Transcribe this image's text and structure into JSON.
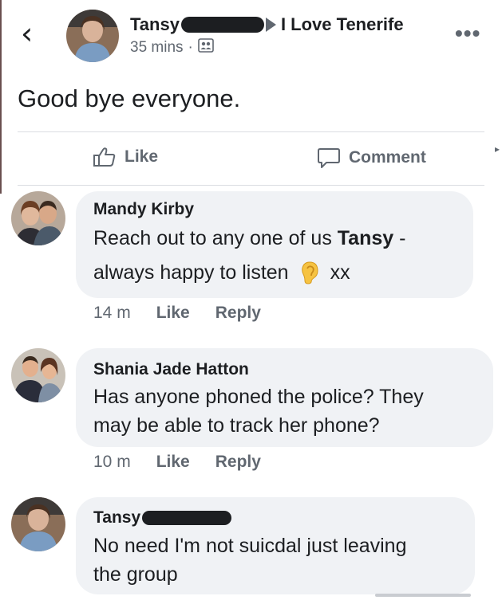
{
  "post": {
    "author": "Tansy",
    "group": "I Love Tenerife",
    "time": "35 mins",
    "separator": "·",
    "text": "Good bye everyone.",
    "like_label": "Like",
    "comment_label": "Comment"
  },
  "comments": [
    {
      "name": "Mandy Kirby",
      "text_prefix": "Reach out to any one of us ",
      "text_bold": "Tansy",
      "text_suffix": " -",
      "text_line2": "always happy to listen",
      "text_end": "xx",
      "time": "14 m",
      "like": "Like",
      "reply": "Reply"
    },
    {
      "name": "Shania Jade Hatton",
      "text_line1": "Has anyone phoned the police? They",
      "text_line2": "may be able to track her phone?",
      "time": "10 m",
      "like": "Like",
      "reply": "Reply"
    },
    {
      "name": "Tansy",
      "text_line1": "No need I'm not suicdal just leaving",
      "text_line2": "the group"
    }
  ],
  "colors": {
    "text": "#1c1e21",
    "secondary": "#606770",
    "bubble": "#f0f2f5"
  }
}
